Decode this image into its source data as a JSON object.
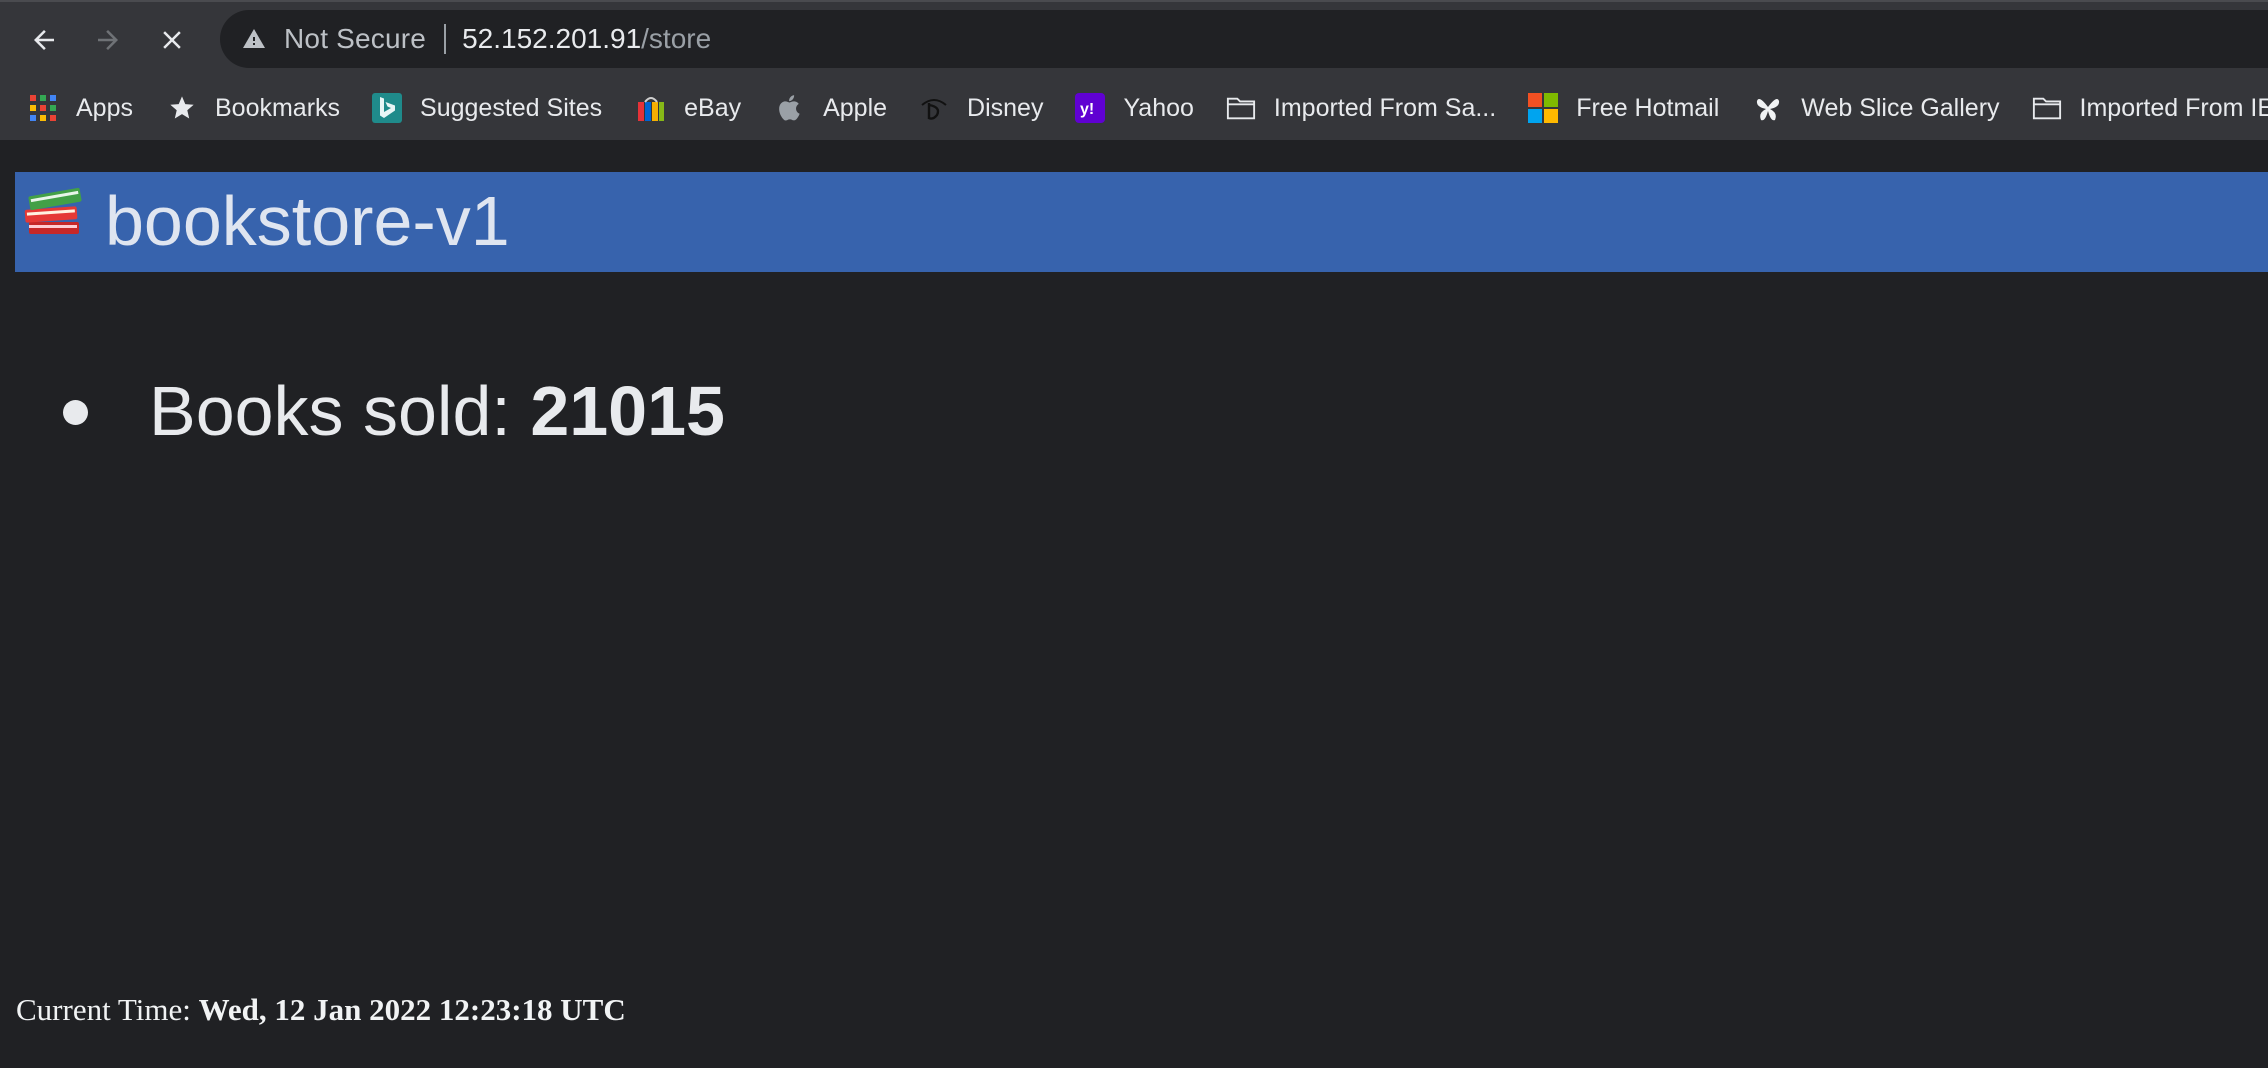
{
  "toolbar": {
    "security_label": "Not Secure",
    "url_host": "52.152.201.91",
    "url_path": "/store"
  },
  "bookmarks": [
    {
      "label": "Apps"
    },
    {
      "label": "Bookmarks"
    },
    {
      "label": "Suggested Sites"
    },
    {
      "label": "eBay"
    },
    {
      "label": "Apple"
    },
    {
      "label": "Disney"
    },
    {
      "label": "Yahoo"
    },
    {
      "label": "Imported From Sa..."
    },
    {
      "label": "Free Hotmail"
    },
    {
      "label": "Web Slice Gallery"
    },
    {
      "label": "Imported From IE"
    }
  ],
  "page": {
    "title": "bookstore-v1",
    "stat_label": "Books sold: ",
    "stat_value": "21015",
    "time_label": "Current Time: ",
    "time_value": "Wed, 12 Jan 2022 12:23:18 UTC"
  },
  "colors": {
    "header_bg": "#3763ad",
    "page_bg": "#202124",
    "chrome_bg": "#35363a"
  }
}
